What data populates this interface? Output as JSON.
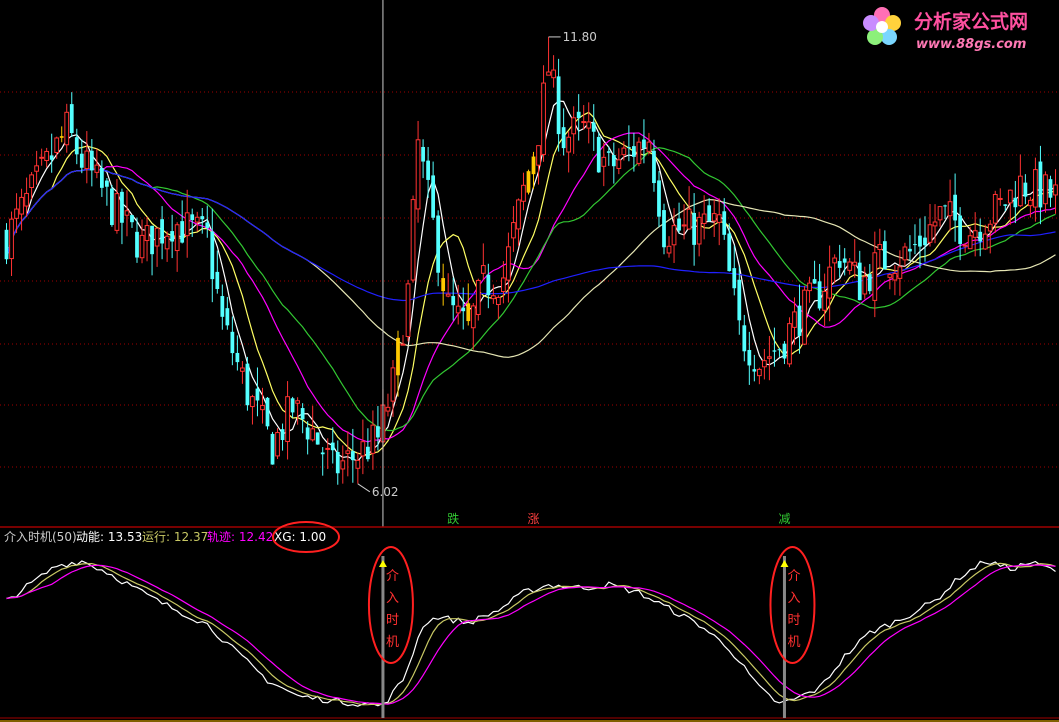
{
  "watermark": {
    "brand": "分析家公式网",
    "url": "www.88gs.com"
  },
  "colors": {
    "up": "#ff3232",
    "down": "#54ffff",
    "highlight": "#ffc800",
    "ma_white": "#ffffff",
    "ma_yellow": "#ffff64",
    "ma_magenta": "#ff00ff",
    "ma_green": "#32c832",
    "ma_cream": "#e6e6b4",
    "ma_blue": "#2020ff",
    "grid": "#a00000",
    "panel_border": "#a00000",
    "circle": "#ff2020"
  },
  "header": {
    "title": "介入时机(50)",
    "items": [
      {
        "label": "动能: ",
        "value": "13.53",
        "color": "#ffffff"
      },
      {
        "label": "运行: ",
        "value": "12.37",
        "color": "#c8c864"
      },
      {
        "label": "轨迹: ",
        "value": "12.42",
        "color": "#ff00ff"
      },
      {
        "label": "XG: ",
        "value": "1.00",
        "color": "#ffffff"
      }
    ]
  },
  "chart_data": [
    {
      "type": "candlestick",
      "ylim": [
        5.5,
        12.2
      ],
      "n_bars": 210,
      "high_label": "11.80",
      "low_label": "6.02",
      "high_value": 11.8,
      "low_value": 6.02,
      "events": [
        {
          "label": "跌",
          "bar": 89,
          "color": "#32c832"
        },
        {
          "label": "涨",
          "bar": 105,
          "color": "#ff4040"
        },
        {
          "label": "减",
          "bar": 155,
          "color": "#32c832"
        }
      ],
      "anchors": [
        [
          0,
          9.2
        ],
        [
          12,
          10.6
        ],
        [
          15,
          10.2
        ],
        [
          22,
          9.5
        ],
        [
          27,
          9.1
        ],
        [
          33,
          9.4
        ],
        [
          40,
          9.2
        ],
        [
          43,
          8.1
        ],
        [
          48,
          7.2
        ],
        [
          53,
          6.5
        ],
        [
          57,
          7.0
        ],
        [
          61,
          6.7
        ],
        [
          65,
          6.2
        ],
        [
          70,
          6.4
        ],
        [
          74,
          6.6
        ],
        [
          77,
          7.3
        ],
        [
          80,
          8.5
        ],
        [
          82,
          10.4
        ],
        [
          86,
          9.0
        ],
        [
          88,
          8.3
        ],
        [
          92,
          8.0
        ],
        [
          95,
          8.6
        ],
        [
          99,
          8.7
        ],
        [
          103,
          9.8
        ],
        [
          106,
          10.6
        ],
        [
          108,
          11.4
        ],
        [
          111,
          10.5
        ],
        [
          115,
          10.6
        ],
        [
          120,
          10.1
        ],
        [
          124,
          10.3
        ],
        [
          128,
          10.5
        ],
        [
          131,
          9.3
        ],
        [
          135,
          9.3
        ],
        [
          142,
          9.4
        ],
        [
          146,
          8.0
        ],
        [
          150,
          7.6
        ],
        [
          154,
          7.8
        ],
        [
          158,
          8.2
        ],
        [
          162,
          8.5
        ],
        [
          166,
          9.0
        ],
        [
          170,
          8.6
        ],
        [
          174,
          8.9
        ],
        [
          180,
          9.0
        ],
        [
          186,
          9.5
        ],
        [
          192,
          9.3
        ],
        [
          198,
          9.6
        ],
        [
          202,
          9.9
        ],
        [
          206,
          9.8
        ],
        [
          210,
          9.7
        ]
      ],
      "ma_periods": [
        5,
        10,
        20,
        30,
        60,
        120
      ],
      "highlight_bars": [
        11,
        78,
        87,
        92,
        104,
        105
      ],
      "cursor_bar": 75
    },
    {
      "type": "line",
      "ylim": [
        0,
        100
      ],
      "series": [
        {
          "name": "动能",
          "color": "#ffffff"
        },
        {
          "name": "运行",
          "color": "#c8c864"
        },
        {
          "name": "轨迹",
          "color": "#ff00ff"
        }
      ],
      "anchors": [
        [
          0,
          70
        ],
        [
          10,
          92
        ],
        [
          15,
          95
        ],
        [
          20,
          88
        ],
        [
          30,
          70
        ],
        [
          40,
          55
        ],
        [
          45,
          40
        ],
        [
          52,
          20
        ],
        [
          58,
          10
        ],
        [
          63,
          8
        ],
        [
          68,
          6
        ],
        [
          72,
          5
        ],
        [
          75,
          4
        ],
        [
          79,
          20
        ],
        [
          83,
          55
        ],
        [
          86,
          60
        ],
        [
          92,
          56
        ],
        [
          98,
          64
        ],
        [
          103,
          75
        ],
        [
          108,
          80
        ],
        [
          115,
          78
        ],
        [
          120,
          80
        ],
        [
          126,
          75
        ],
        [
          132,
          65
        ],
        [
          138,
          55
        ],
        [
          144,
          40
        ],
        [
          150,
          15
        ],
        [
          154,
          5
        ],
        [
          157,
          8
        ],
        [
          162,
          15
        ],
        [
          167,
          35
        ],
        [
          172,
          50
        ],
        [
          178,
          58
        ],
        [
          185,
          70
        ],
        [
          190,
          85
        ],
        [
          195,
          95
        ],
        [
          200,
          90
        ],
        [
          204,
          94
        ],
        [
          210,
          88
        ]
      ],
      "signals": [
        {
          "bar": 75,
          "text": "介入时机"
        },
        {
          "bar": 155,
          "text": "介入时机"
        }
      ],
      "circled_value_label": "XG: 1.00"
    }
  ]
}
